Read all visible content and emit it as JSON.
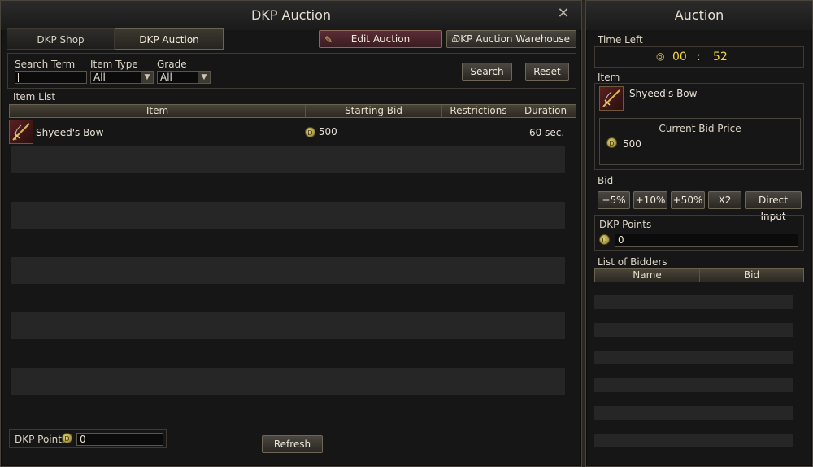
{
  "dkp_auction_window": {
    "title": "DKP Auction",
    "tabs": [
      {
        "label": "DKP Shop"
      },
      {
        "label": "DKP Auction"
      }
    ],
    "edit_auction_label": "Edit Auction",
    "warehouse_label": "DKP Auction Warehouse",
    "search": {
      "term_label": "Search Term",
      "term_value": "",
      "item_type_label": "Item Type",
      "item_type_value": "All",
      "grade_label": "Grade",
      "grade_value": "All",
      "search_button": "Search",
      "reset_button": "Reset"
    },
    "item_list": {
      "label": "Item List",
      "columns": [
        "Item",
        "Starting Bid",
        "Restrictions",
        "Duration"
      ],
      "rows": [
        {
          "item": "Shyeed's Bow",
          "starting_bid": "500",
          "restrictions": "-",
          "duration": "60 sec."
        }
      ]
    },
    "footer": {
      "dkp_points_label": "DKP Points",
      "dkp_points_value": "0",
      "refresh_button": "Refresh"
    }
  },
  "auction_panel": {
    "title": "Auction",
    "time_left_label": "Time Left",
    "time_left_minutes": "00",
    "time_left_separator": ":",
    "time_left_seconds": "52",
    "item_label": "Item",
    "item_name": "Shyeed's Bow",
    "current_bid_label": "Current Bid Price",
    "current_bid_value": "500",
    "bid_label": "Bid",
    "bid_buttons": [
      "+5%",
      "+10%",
      "+50%",
      "X2",
      "Direct Input"
    ],
    "dkp_points_label": "DKP Points",
    "dkp_points_value": "0",
    "bidders_label": "List of Bidders",
    "bidders_columns": [
      "Name",
      "Bid"
    ],
    "coin_glyph": "D",
    "colors": {
      "timer": "#f2d83a",
      "accent_red": "#5b2d36"
    }
  }
}
